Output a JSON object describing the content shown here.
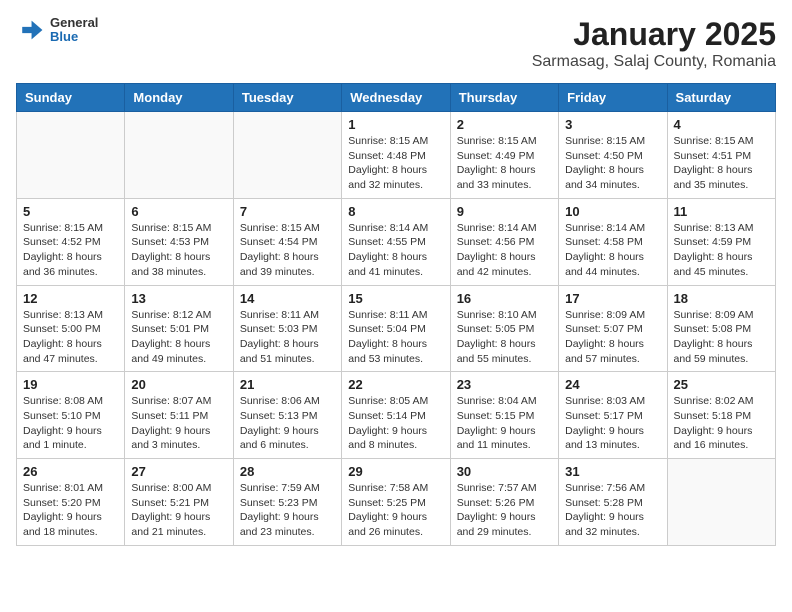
{
  "app": {
    "logo_line1": "General",
    "logo_line2": "Blue",
    "title": "January 2025",
    "subtitle": "Sarmasag, Salaj County, Romania"
  },
  "weekdays": [
    "Sunday",
    "Monday",
    "Tuesday",
    "Wednesday",
    "Thursday",
    "Friday",
    "Saturday"
  ],
  "weeks": [
    [
      {
        "day": "",
        "info": ""
      },
      {
        "day": "",
        "info": ""
      },
      {
        "day": "",
        "info": ""
      },
      {
        "day": "1",
        "info": "Sunrise: 8:15 AM\nSunset: 4:48 PM\nDaylight: 8 hours\nand 32 minutes."
      },
      {
        "day": "2",
        "info": "Sunrise: 8:15 AM\nSunset: 4:49 PM\nDaylight: 8 hours\nand 33 minutes."
      },
      {
        "day": "3",
        "info": "Sunrise: 8:15 AM\nSunset: 4:50 PM\nDaylight: 8 hours\nand 34 minutes."
      },
      {
        "day": "4",
        "info": "Sunrise: 8:15 AM\nSunset: 4:51 PM\nDaylight: 8 hours\nand 35 minutes."
      }
    ],
    [
      {
        "day": "5",
        "info": "Sunrise: 8:15 AM\nSunset: 4:52 PM\nDaylight: 8 hours\nand 36 minutes."
      },
      {
        "day": "6",
        "info": "Sunrise: 8:15 AM\nSunset: 4:53 PM\nDaylight: 8 hours\nand 38 minutes."
      },
      {
        "day": "7",
        "info": "Sunrise: 8:15 AM\nSunset: 4:54 PM\nDaylight: 8 hours\nand 39 minutes."
      },
      {
        "day": "8",
        "info": "Sunrise: 8:14 AM\nSunset: 4:55 PM\nDaylight: 8 hours\nand 41 minutes."
      },
      {
        "day": "9",
        "info": "Sunrise: 8:14 AM\nSunset: 4:56 PM\nDaylight: 8 hours\nand 42 minutes."
      },
      {
        "day": "10",
        "info": "Sunrise: 8:14 AM\nSunset: 4:58 PM\nDaylight: 8 hours\nand 44 minutes."
      },
      {
        "day": "11",
        "info": "Sunrise: 8:13 AM\nSunset: 4:59 PM\nDaylight: 8 hours\nand 45 minutes."
      }
    ],
    [
      {
        "day": "12",
        "info": "Sunrise: 8:13 AM\nSunset: 5:00 PM\nDaylight: 8 hours\nand 47 minutes."
      },
      {
        "day": "13",
        "info": "Sunrise: 8:12 AM\nSunset: 5:01 PM\nDaylight: 8 hours\nand 49 minutes."
      },
      {
        "day": "14",
        "info": "Sunrise: 8:11 AM\nSunset: 5:03 PM\nDaylight: 8 hours\nand 51 minutes."
      },
      {
        "day": "15",
        "info": "Sunrise: 8:11 AM\nSunset: 5:04 PM\nDaylight: 8 hours\nand 53 minutes."
      },
      {
        "day": "16",
        "info": "Sunrise: 8:10 AM\nSunset: 5:05 PM\nDaylight: 8 hours\nand 55 minutes."
      },
      {
        "day": "17",
        "info": "Sunrise: 8:09 AM\nSunset: 5:07 PM\nDaylight: 8 hours\nand 57 minutes."
      },
      {
        "day": "18",
        "info": "Sunrise: 8:09 AM\nSunset: 5:08 PM\nDaylight: 8 hours\nand 59 minutes."
      }
    ],
    [
      {
        "day": "19",
        "info": "Sunrise: 8:08 AM\nSunset: 5:10 PM\nDaylight: 9 hours\nand 1 minute."
      },
      {
        "day": "20",
        "info": "Sunrise: 8:07 AM\nSunset: 5:11 PM\nDaylight: 9 hours\nand 3 minutes."
      },
      {
        "day": "21",
        "info": "Sunrise: 8:06 AM\nSunset: 5:13 PM\nDaylight: 9 hours\nand 6 minutes."
      },
      {
        "day": "22",
        "info": "Sunrise: 8:05 AM\nSunset: 5:14 PM\nDaylight: 9 hours\nand 8 minutes."
      },
      {
        "day": "23",
        "info": "Sunrise: 8:04 AM\nSunset: 5:15 PM\nDaylight: 9 hours\nand 11 minutes."
      },
      {
        "day": "24",
        "info": "Sunrise: 8:03 AM\nSunset: 5:17 PM\nDaylight: 9 hours\nand 13 minutes."
      },
      {
        "day": "25",
        "info": "Sunrise: 8:02 AM\nSunset: 5:18 PM\nDaylight: 9 hours\nand 16 minutes."
      }
    ],
    [
      {
        "day": "26",
        "info": "Sunrise: 8:01 AM\nSunset: 5:20 PM\nDaylight: 9 hours\nand 18 minutes."
      },
      {
        "day": "27",
        "info": "Sunrise: 8:00 AM\nSunset: 5:21 PM\nDaylight: 9 hours\nand 21 minutes."
      },
      {
        "day": "28",
        "info": "Sunrise: 7:59 AM\nSunset: 5:23 PM\nDaylight: 9 hours\nand 23 minutes."
      },
      {
        "day": "29",
        "info": "Sunrise: 7:58 AM\nSunset: 5:25 PM\nDaylight: 9 hours\nand 26 minutes."
      },
      {
        "day": "30",
        "info": "Sunrise: 7:57 AM\nSunset: 5:26 PM\nDaylight: 9 hours\nand 29 minutes."
      },
      {
        "day": "31",
        "info": "Sunrise: 7:56 AM\nSunset: 5:28 PM\nDaylight: 9 hours\nand 32 minutes."
      },
      {
        "day": "",
        "info": ""
      }
    ]
  ]
}
